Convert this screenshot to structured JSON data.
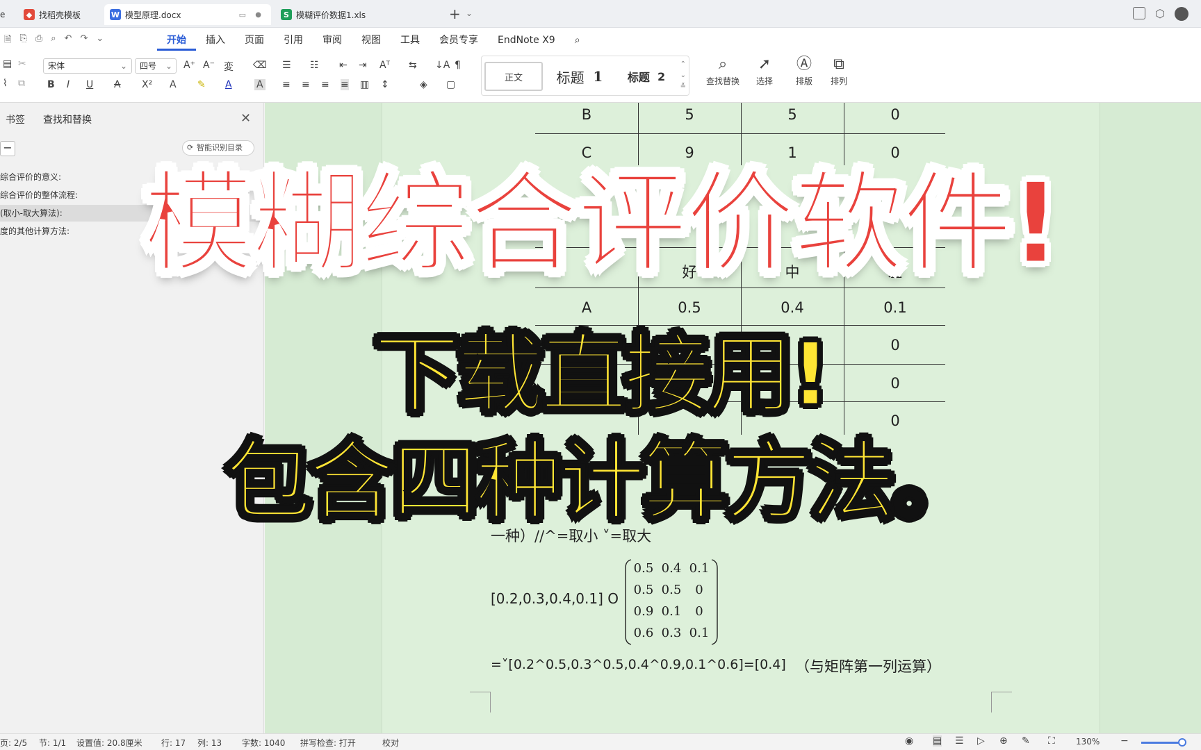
{
  "tabs": [
    {
      "label": "e",
      "icon": ""
    },
    {
      "label": "找稻壳模板",
      "icon": "wps-docer-icon"
    },
    {
      "label": "模型原理.docx",
      "icon": "W"
    },
    {
      "label": "模糊评价数据1.xls",
      "icon": "S"
    }
  ],
  "menus": [
    "开始",
    "插入",
    "页面",
    "引用",
    "审阅",
    "视图",
    "工具",
    "会员专享",
    "EndNote X9"
  ],
  "ribbon": {
    "font_name": "宋体",
    "font_size": "四号",
    "styles": {
      "normal": "正文",
      "h1": "标题",
      "h1_num": "1",
      "h2": "标题",
      "h2_num": "2"
    },
    "find_replace": "查找替换",
    "select": "选择",
    "arrange_layout": "排版",
    "arrange_order": "排列"
  },
  "left_panel": {
    "tab_bookmark": "书签",
    "tab_find": "查找和替换",
    "smart_btn": "智能识别目录",
    "outline": [
      "综合评价的意义:",
      "综合评价的整体流程:",
      "(取小-取大算法):",
      "度的其他计算方法:"
    ]
  },
  "doc": {
    "table_top": [
      [
        "B",
        "5",
        "5",
        "0"
      ],
      [
        "C",
        "9",
        "1",
        "0"
      ]
    ],
    "partial_char": "化",
    "header_partial": [
      "好",
      "中",
      "差"
    ],
    "table_bottom": [
      [
        "A",
        "0.5",
        "0.4",
        "0.1"
      ],
      [
        "",
        "",
        "",
        "0"
      ],
      [
        "",
        "",
        "",
        "0"
      ],
      [
        "",
        "",
        "",
        "0"
      ]
    ],
    "method_line": "一种）//^=取小     ˅=取大",
    "vector": "[0.2,0.3,0.4,0.1] O",
    "matrix": [
      [
        "0.5",
        "0.4",
        "0.1"
      ],
      [
        "0.5",
        "0.5",
        "0"
      ],
      [
        "0.9",
        "0.1",
        "0"
      ],
      [
        "0.6",
        "0.3",
        "0.1"
      ]
    ],
    "result_line": "=˅[0.2^0.5,0.3^0.5,0.4^0.9,0.1^0.6]=[0.4]",
    "result_note": "（与矩阵第一列运算）"
  },
  "overlay": {
    "line1": "模糊综合评价软件!",
    "line2": "下载直接用!",
    "line3": "包含四种计算方法。"
  },
  "status": {
    "page": "页: 2/5",
    "section": "节: 1/1",
    "set_value": "设置值: 20.8厘米",
    "row": "行: 17",
    "col": "列: 13",
    "words": "字数: 1040",
    "spell": "拼写检查: 打开",
    "proof": "校对",
    "zoom": "130%"
  }
}
